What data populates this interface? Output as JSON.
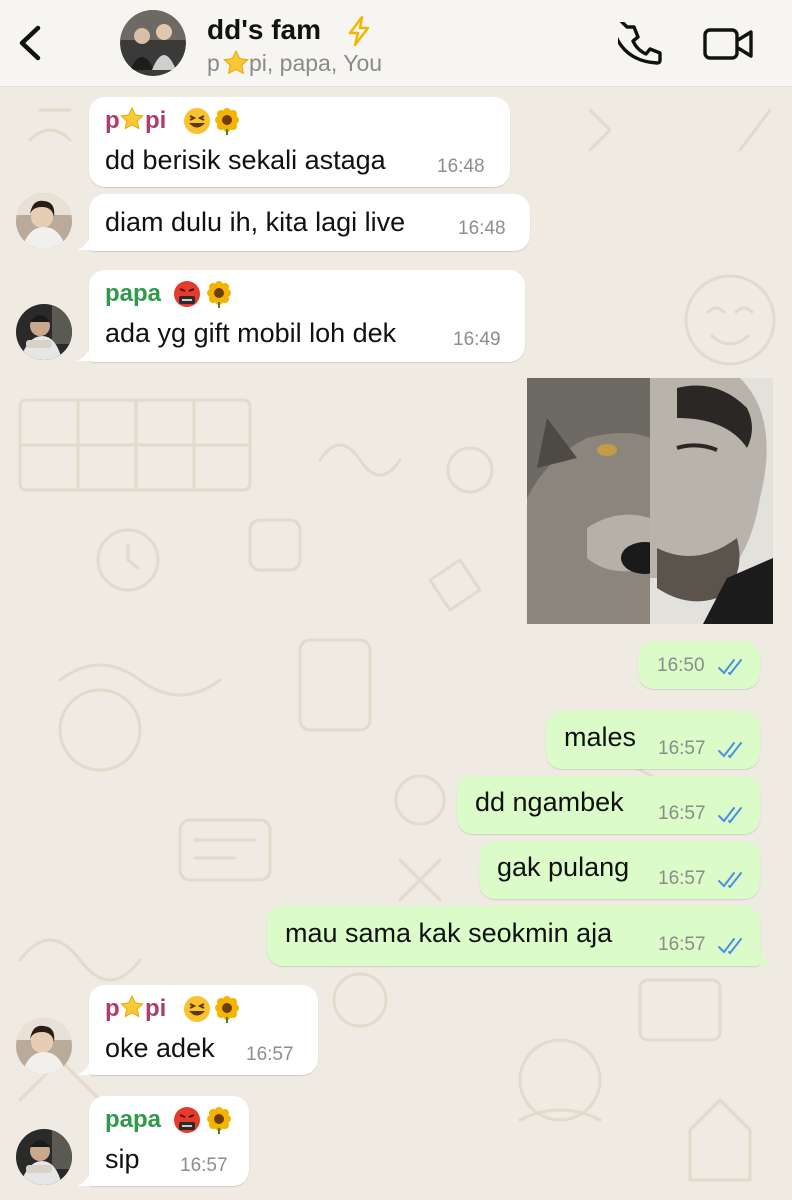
{
  "header": {
    "title": "dd's fam",
    "subtitle_p": "p",
    "subtitle_rest": "pi, papa, You"
  },
  "messages": [
    {
      "sender": "p",
      "sender_rest": "pi",
      "text": "dd berisik sekali astaga",
      "time": "16:48"
    },
    {
      "text": "diam dulu ih, kita lagi live",
      "time": "16:48"
    },
    {
      "sender": "papa",
      "text": "ada yg gift mobil loh dek",
      "time": "16:49"
    },
    {
      "time": "16:50"
    },
    {
      "text": "males",
      "time": "16:57"
    },
    {
      "text": "dd ngambek",
      "time": "16:57"
    },
    {
      "text": "gak pulang",
      "time": "16:57"
    },
    {
      "text": "mau sama kak seokmin aja",
      "time": "16:57"
    },
    {
      "sender": "p",
      "sender_rest": "pi",
      "text": "oke adek",
      "time": "16:57"
    },
    {
      "sender": "papa",
      "text": "sip",
      "time": "16:57"
    }
  ],
  "colors": {
    "header_bg": "#f6f5f1",
    "chat_bg": "#efeae2",
    "incoming_bubble": "#ffffff",
    "outgoing_bubble": "#dbfcc9",
    "sender_papi": "#b03c6e",
    "sender_papa": "#2f9a49",
    "read_ticks": "#4a90e2"
  },
  "icons": [
    "back-chevron-icon",
    "lightning-icon",
    "star-icon",
    "grinning-squint-emoji-icon",
    "sunflower-emoji-icon",
    "cursing-face-emoji-icon",
    "phone-icon",
    "video-camera-icon",
    "double-check-icon"
  ]
}
